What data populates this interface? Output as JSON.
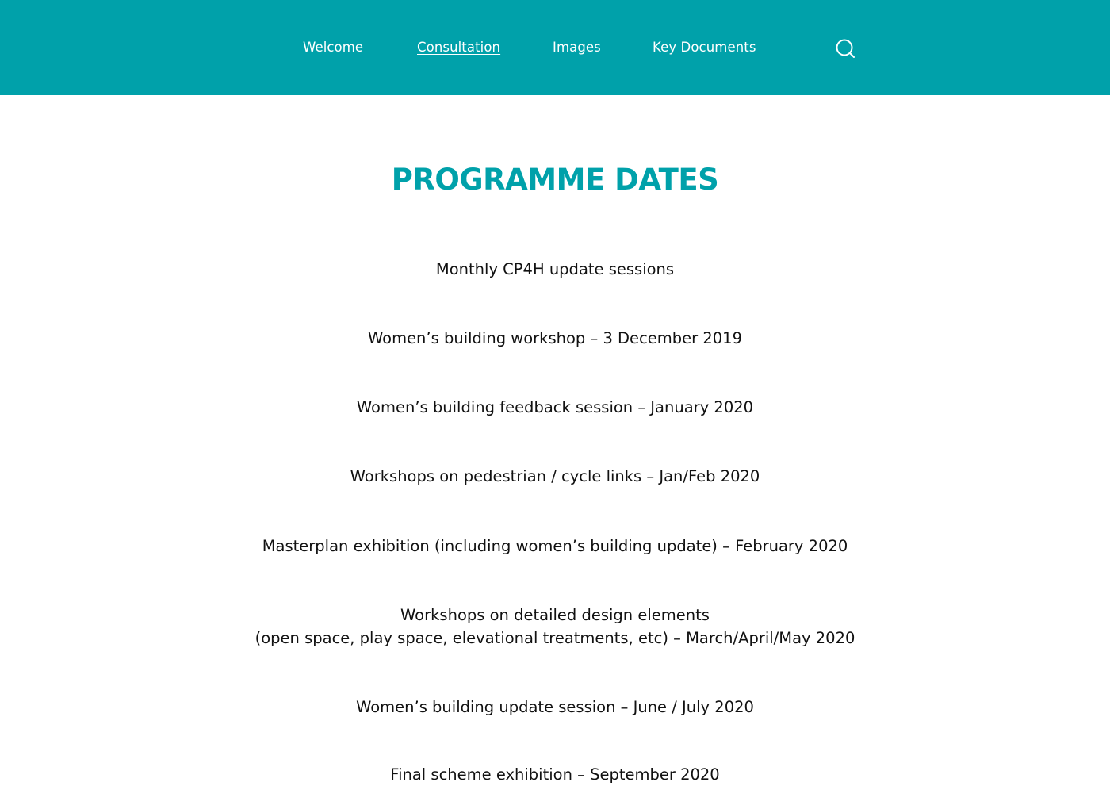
{
  "nav": {
    "links": [
      {
        "label": "Welcome",
        "active": false
      },
      {
        "label": "Consultation",
        "active": true
      },
      {
        "label": "Images",
        "active": false
      },
      {
        "label": "Key Documents",
        "active": false
      }
    ],
    "search_icon": "search-icon"
  },
  "main": {
    "title": "PROGRAMME DATES",
    "items": [
      {
        "lines": [
          "Monthly CP4H update sessions"
        ]
      },
      {
        "lines": [
          "Women’s building workshop – 3 December 2019"
        ]
      },
      {
        "lines": [
          "Women’s building feedback session – January 2020"
        ]
      },
      {
        "lines": [
          "Workshops on pedestrian / cycle links – Jan/Feb 2020"
        ]
      },
      {
        "lines": [
          "Masterplan exhibition (including women’s building update) – February 2020"
        ]
      },
      {
        "lines": [
          "Workshops on detailed design elements",
          "(open space, play space, elevational treatments, etc) – March/April/May 2020"
        ]
      },
      {
        "lines": [
          "Women’s building update session – June / July 2020"
        ]
      },
      {
        "lines": [
          "Final scheme exhibition – September 2020"
        ]
      }
    ]
  },
  "colors": {
    "brand": "#00a1aa",
    "text": "#111111",
    "background": "#ffffff"
  }
}
